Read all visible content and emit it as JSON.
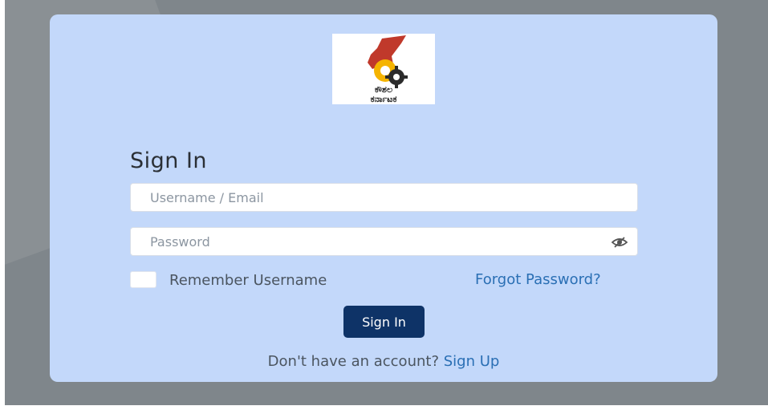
{
  "logo": {
    "text_line1": "ಕೌಶಲ",
    "text_line2": "ಕರ್ನಾಟಕ"
  },
  "form": {
    "title": "Sign In",
    "username_placeholder": "Username / Email",
    "password_placeholder": "Password",
    "remember_label": "Remember Username",
    "forgot_label": "Forgot Password?",
    "submit_label": "Sign In",
    "signup_prompt": "Don't have an account?",
    "signup_link": "Sign Up"
  },
  "colors": {
    "backdrop": "#7f868b",
    "card": "#c3d8fa",
    "button": "#0e3367",
    "link": "#2a6fb4"
  },
  "icons": {
    "password_toggle": "eye-slash-icon"
  }
}
